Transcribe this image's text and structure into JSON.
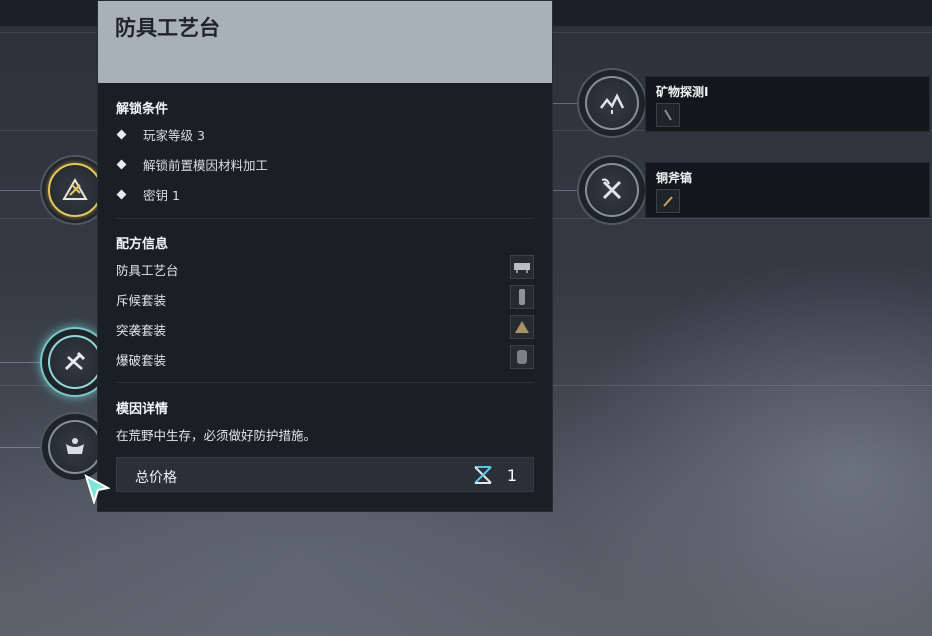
{
  "panel": {
    "title": "防具工艺台",
    "unlock": {
      "heading": "解锁条件",
      "conditions": [
        "玩家等级 3",
        "解锁前置模因材料加工",
        "密钥 1"
      ]
    },
    "recipe": {
      "heading": "配方信息",
      "items": [
        "防具工艺台",
        "斥候套装",
        "突袭套装",
        "爆破套装"
      ]
    },
    "meme": {
      "heading": "模因详情",
      "description": "在荒野中生存，必须做好防护措施。"
    },
    "price": {
      "label": "总价格",
      "icon": "gene-helix-icon",
      "value": "1"
    }
  },
  "right_skills": [
    {
      "title": "矿物探测Ⅰ",
      "icon": "mineral-detect-icon"
    },
    {
      "title": "铜斧镐",
      "icon": "axe-pickaxe-icon"
    }
  ],
  "left_nodes": [
    "armor-bench-icon",
    "wrench-gun-icon",
    "muscle-body-icon"
  ],
  "colors": {
    "gold_ring": "#e7c65a",
    "glow": "#7ee6e6",
    "header": "#a8b0b9",
    "panel_bg": "#1a1f26"
  }
}
